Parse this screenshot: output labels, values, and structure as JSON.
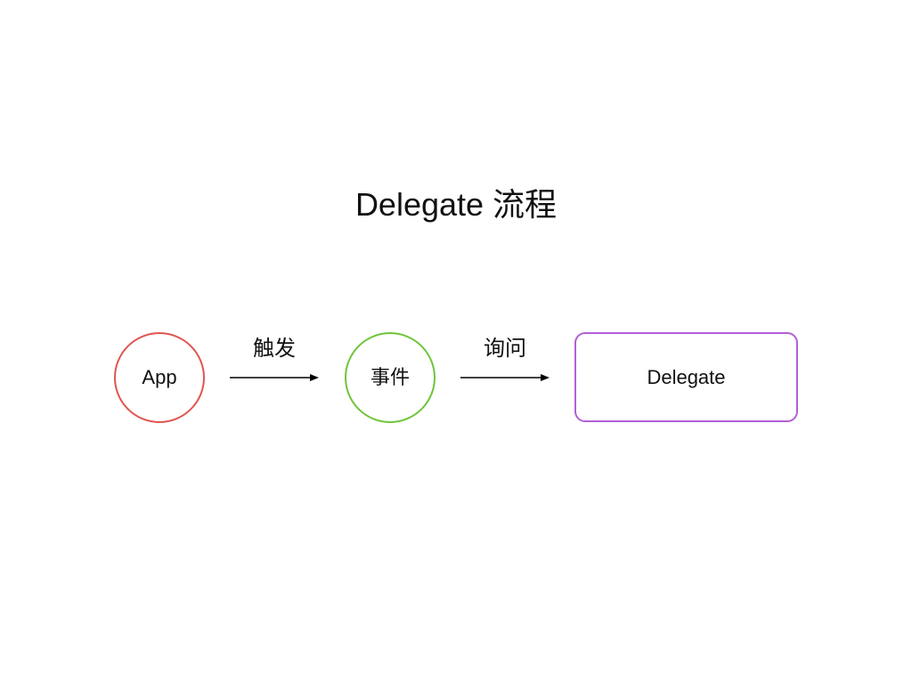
{
  "title": "Delegate 流程",
  "nodes": {
    "app": {
      "label": "App",
      "color": "#e0554f",
      "shape": "circle"
    },
    "event": {
      "label": "事件",
      "color": "#6fc53a",
      "shape": "circle"
    },
    "delegate": {
      "label": "Delegate",
      "color": "#b35fd6",
      "shape": "rounded-rectangle"
    }
  },
  "edges": [
    {
      "from": "app",
      "to": "event",
      "label": "触发"
    },
    {
      "from": "event",
      "to": "delegate",
      "label": "询问"
    }
  ]
}
